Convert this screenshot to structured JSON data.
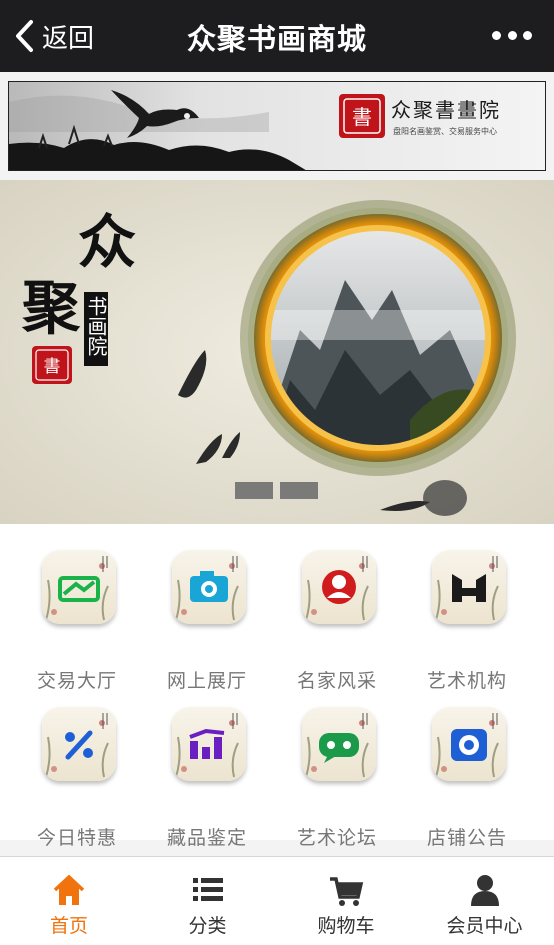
{
  "nav": {
    "back_label": "返回",
    "title": "众聚书画商城"
  },
  "banner": {
    "seal_char": "書",
    "name": "众聚書畫院",
    "tagline": "盘阳名画鉴赏、交易服务中心"
  },
  "hero": {
    "seal_char": "書",
    "title_big_1": "众",
    "title_big_2": "聚",
    "title_small": "书画院",
    "slide_count": 2
  },
  "menu": [
    {
      "label": "交易大厅",
      "icon": "handshake-icon",
      "color": "#19b34a"
    },
    {
      "label": "网上展厅",
      "icon": "camera-icon",
      "color": "#19a6d6"
    },
    {
      "label": "名家风采",
      "icon": "person-icon",
      "color": "#d01c1c"
    },
    {
      "label": "艺术机构",
      "icon": "building-icon",
      "color": "#1a1a1a"
    },
    {
      "label": "今日特惠",
      "icon": "percent-icon",
      "color": "#1f5fd6"
    },
    {
      "label": "藏品鉴定",
      "icon": "chart-icon",
      "color": "#6a1fc2"
    },
    {
      "label": "艺术论坛",
      "icon": "chat-icon",
      "color": "#1b9a4a"
    },
    {
      "label": "店铺公告",
      "icon": "speaker-icon",
      "color": "#1f5fd6"
    }
  ],
  "tabs": [
    {
      "label": "首页",
      "icon": "home-icon",
      "active": true
    },
    {
      "label": "分类",
      "icon": "list-icon",
      "active": false
    },
    {
      "label": "购物车",
      "icon": "cart-icon",
      "active": false
    },
    {
      "label": "会员中心",
      "icon": "user-icon",
      "active": false
    }
  ],
  "colors": {
    "accent": "#f0730d",
    "topbar": "#1d1d1f",
    "seal": "#c0141b"
  }
}
